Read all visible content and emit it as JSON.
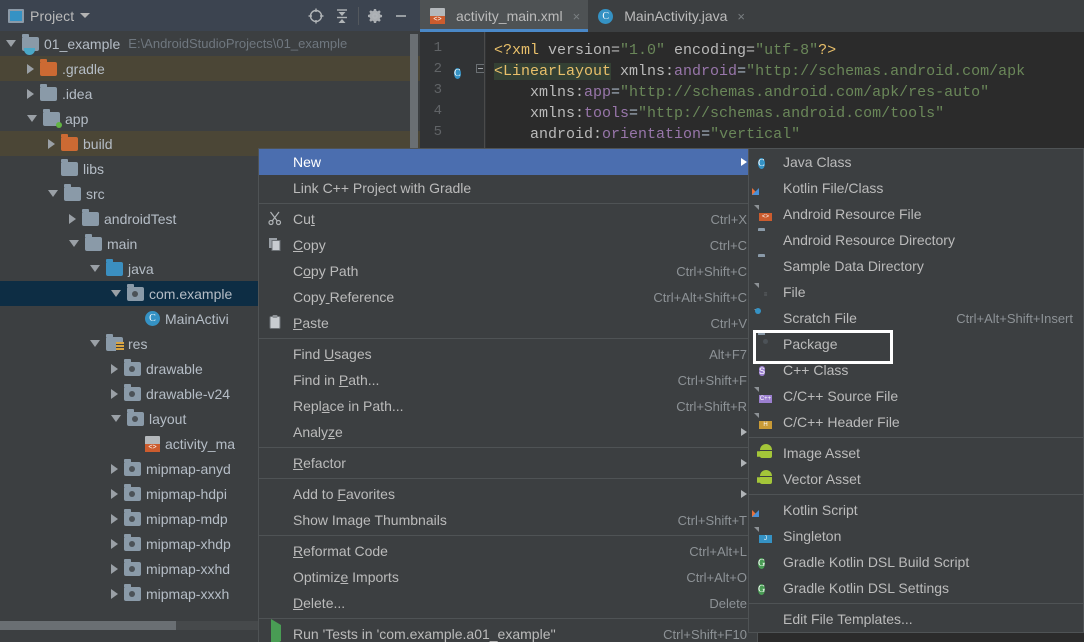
{
  "project_panel": {
    "title": "Project",
    "toolbar": [
      {
        "name": "locate-icon",
        "label": "Select Opened File"
      },
      {
        "name": "collapse-all-icon",
        "label": "Collapse All"
      },
      {
        "name": "gear-icon",
        "label": "Settings"
      },
      {
        "name": "minimize-icon",
        "label": "Hide"
      }
    ],
    "tree": [
      {
        "label": "01_example",
        "path": "E:\\AndroidStudioProjects\\01_example",
        "indent": 0,
        "arrow": "down",
        "icon": "project-folder",
        "state": "normal"
      },
      {
        "label": ".gradle",
        "path": "",
        "indent": 1,
        "arrow": "right",
        "icon": "folder-orange",
        "state": "changed"
      },
      {
        "label": ".idea",
        "path": "",
        "indent": 1,
        "arrow": "right",
        "icon": "folder",
        "state": "normal"
      },
      {
        "label": "app",
        "path": "",
        "indent": 1,
        "arrow": "down",
        "icon": "folder-module",
        "state": "normal"
      },
      {
        "label": "build",
        "path": "",
        "indent": 2,
        "arrow": "right",
        "icon": "folder-orange",
        "state": "changed"
      },
      {
        "label": "libs",
        "path": "",
        "indent": 2,
        "arrow": "none",
        "icon": "folder",
        "state": "normal"
      },
      {
        "label": "src",
        "path": "",
        "indent": 2,
        "arrow": "down",
        "icon": "folder",
        "state": "normal"
      },
      {
        "label": "androidTest",
        "path": "",
        "indent": 3,
        "arrow": "right",
        "icon": "folder",
        "state": "normal"
      },
      {
        "label": "main",
        "path": "",
        "indent": 3,
        "arrow": "down",
        "icon": "folder",
        "state": "normal"
      },
      {
        "label": "java",
        "path": "",
        "indent": 4,
        "arrow": "down",
        "icon": "folder-blue",
        "state": "normal"
      },
      {
        "label": "com.example",
        "path": "",
        "indent": 5,
        "arrow": "down",
        "icon": "package",
        "state": "selected"
      },
      {
        "label": "MainActivi",
        "path": "",
        "indent": 6,
        "arrow": "none",
        "icon": "java-class",
        "state": "normal"
      },
      {
        "label": "res",
        "path": "",
        "indent": 4,
        "arrow": "down",
        "icon": "res-folder",
        "state": "normal"
      },
      {
        "label": "drawable",
        "path": "",
        "indent": 5,
        "arrow": "right",
        "icon": "package",
        "state": "normal"
      },
      {
        "label": "drawable-v24",
        "path": "",
        "indent": 5,
        "arrow": "right",
        "icon": "package",
        "state": "normal"
      },
      {
        "label": "layout",
        "path": "",
        "indent": 5,
        "arrow": "down",
        "icon": "package",
        "state": "normal"
      },
      {
        "label": "activity_ma",
        "path": "",
        "indent": 6,
        "arrow": "none",
        "icon": "xml-file",
        "state": "normal"
      },
      {
        "label": "mipmap-anyd",
        "path": "",
        "indent": 5,
        "arrow": "right",
        "icon": "package",
        "state": "normal"
      },
      {
        "label": "mipmap-hdpi",
        "path": "",
        "indent": 5,
        "arrow": "right",
        "icon": "package",
        "state": "normal"
      },
      {
        "label": "mipmap-mdp",
        "path": "",
        "indent": 5,
        "arrow": "right",
        "icon": "package",
        "state": "normal"
      },
      {
        "label": "mipmap-xhdp",
        "path": "",
        "indent": 5,
        "arrow": "right",
        "icon": "package",
        "state": "normal"
      },
      {
        "label": "mipmap-xxhd",
        "path": "",
        "indent": 5,
        "arrow": "right",
        "icon": "package",
        "state": "normal"
      },
      {
        "label": "mipmap-xxxh",
        "path": "",
        "indent": 5,
        "arrow": "right",
        "icon": "package",
        "state": "normal"
      }
    ]
  },
  "editor": {
    "tabs": [
      {
        "label": "activity_main.xml",
        "icon": "xml-file-icon",
        "active": true,
        "close": "×"
      },
      {
        "label": "MainActivity.java",
        "icon": "java-class-icon",
        "active": false,
        "close": "×"
      }
    ],
    "line_numbers": [
      "1",
      "2",
      "3",
      "4",
      "5"
    ],
    "code_lines": [
      {
        "n": "1",
        "parts": [
          {
            "t": "<?xml ",
            "c": "k-proc"
          },
          {
            "t": "version=",
            "c": "k-attr"
          },
          {
            "t": "\"1.0\"",
            "c": "k-str"
          },
          {
            "t": " encoding=",
            "c": "k-attr"
          },
          {
            "t": "\"utf-8\"",
            "c": "k-str"
          },
          {
            "t": "?>",
            "c": "k-proc"
          }
        ]
      },
      {
        "n": "2",
        "parts": [
          {
            "t": "<LinearLayout",
            "c": "k-tagname hl-tag"
          },
          {
            "t": " xmlns:",
            "c": "k-attr"
          },
          {
            "t": "android",
            "c": "k-ns"
          },
          {
            "t": "=",
            "c": "k-punct"
          },
          {
            "t": "\"http://schemas.android.com/apk",
            "c": "k-str"
          }
        ]
      },
      {
        "n": "3",
        "parts": [
          {
            "t": "    xmlns:",
            "c": "k-attr"
          },
          {
            "t": "app",
            "c": "k-ns"
          },
          {
            "t": "=",
            "c": "k-punct"
          },
          {
            "t": "\"http://schemas.android.com/apk/res-auto\"",
            "c": "k-str"
          }
        ]
      },
      {
        "n": "4",
        "parts": [
          {
            "t": "    xmlns:",
            "c": "k-attr"
          },
          {
            "t": "tools",
            "c": "k-ns"
          },
          {
            "t": "=",
            "c": "k-punct"
          },
          {
            "t": "\"http://schemas.android.com/tools\"",
            "c": "k-str"
          }
        ]
      },
      {
        "n": "5",
        "parts": [
          {
            "t": "    android:",
            "c": "k-attr"
          },
          {
            "t": "orientation",
            "c": "k-ns"
          },
          {
            "t": "=",
            "c": "k-punct"
          },
          {
            "t": "\"vertical\"",
            "c": "k-str"
          }
        ]
      }
    ]
  },
  "context_menu": {
    "items": [
      {
        "label": "New",
        "shortcut": "",
        "icon": "",
        "submenu": true,
        "selected": true,
        "mnemonic": ""
      },
      {
        "label": "Link C++ Project with Gradle",
        "shortcut": "",
        "icon": "",
        "submenu": false,
        "selected": false
      },
      {
        "sep": true
      },
      {
        "label": "Cut",
        "shortcut": "Ctrl+X",
        "icon": "scissors-icon",
        "submenu": false,
        "selected": false
      },
      {
        "label": "Copy",
        "shortcut": "Ctrl+C",
        "icon": "copy-icon",
        "submenu": false,
        "selected": false
      },
      {
        "label": "Copy Path",
        "shortcut": "Ctrl+Shift+C",
        "icon": "",
        "submenu": false,
        "selected": false
      },
      {
        "label": "Copy Reference",
        "shortcut": "Ctrl+Alt+Shift+C",
        "icon": "",
        "submenu": false,
        "selected": false
      },
      {
        "label": "Paste",
        "shortcut": "Ctrl+V",
        "icon": "paste-icon",
        "submenu": false,
        "selected": false
      },
      {
        "sep": true
      },
      {
        "label": "Find Usages",
        "shortcut": "Alt+F7",
        "icon": "",
        "submenu": false,
        "selected": false
      },
      {
        "label": "Find in Path...",
        "shortcut": "Ctrl+Shift+F",
        "icon": "",
        "submenu": false,
        "selected": false
      },
      {
        "label": "Replace in Path...",
        "shortcut": "Ctrl+Shift+R",
        "icon": "",
        "submenu": false,
        "selected": false
      },
      {
        "label": "Analyze",
        "shortcut": "",
        "icon": "",
        "submenu": true,
        "selected": false
      },
      {
        "sep": true
      },
      {
        "label": "Refactor",
        "shortcut": "",
        "icon": "",
        "submenu": true,
        "selected": false
      },
      {
        "sep": true
      },
      {
        "label": "Add to Favorites",
        "shortcut": "",
        "icon": "",
        "submenu": true,
        "selected": false
      },
      {
        "label": "Show Image Thumbnails",
        "shortcut": "Ctrl+Shift+T",
        "icon": "",
        "submenu": false,
        "selected": false
      },
      {
        "sep": true
      },
      {
        "label": "Reformat Code",
        "shortcut": "Ctrl+Alt+L",
        "icon": "",
        "submenu": false,
        "selected": false
      },
      {
        "label": "Optimize Imports",
        "shortcut": "Ctrl+Alt+O",
        "icon": "",
        "submenu": false,
        "selected": false
      },
      {
        "label": "Delete...",
        "shortcut": "Delete",
        "icon": "",
        "submenu": false,
        "selected": false
      },
      {
        "sep": true
      },
      {
        "label": "Run 'Tests in 'com.example.a01_example''",
        "shortcut": "Ctrl+Shift+F10",
        "icon": "run-icon",
        "submenu": false,
        "selected": false
      }
    ]
  },
  "new_submenu": {
    "items": [
      {
        "label": "Java Class",
        "shortcut": "",
        "icon": "java-class-icon",
        "boxed": false
      },
      {
        "label": "Kotlin File/Class",
        "shortcut": "",
        "icon": "kotlin-file-icon",
        "boxed": false
      },
      {
        "label": "Android Resource File",
        "shortcut": "",
        "icon": "android-resource-file-icon",
        "boxed": false
      },
      {
        "label": "Android Resource Directory",
        "shortcut": "",
        "icon": "folder-icon",
        "boxed": false
      },
      {
        "label": "Sample Data Directory",
        "shortcut": "",
        "icon": "folder-icon",
        "boxed": false
      },
      {
        "label": "File",
        "shortcut": "",
        "icon": "file-icon",
        "boxed": false
      },
      {
        "label": "Scratch File",
        "shortcut": "Ctrl+Alt+Shift+Insert",
        "icon": "scratch-file-icon",
        "boxed": false
      },
      {
        "label": "Package",
        "shortcut": "",
        "icon": "package-icon",
        "boxed": true
      },
      {
        "label": "C++ Class",
        "shortcut": "",
        "icon": "cpp-class-icon",
        "boxed": false
      },
      {
        "label": "C/C++ Source File",
        "shortcut": "",
        "icon": "cpp-source-icon",
        "boxed": false
      },
      {
        "label": "C/C++ Header File",
        "shortcut": "",
        "icon": "cpp-header-icon",
        "boxed": false
      },
      {
        "sep": true
      },
      {
        "label": "Image Asset",
        "shortcut": "",
        "icon": "android-icon",
        "boxed": false
      },
      {
        "label": "Vector Asset",
        "shortcut": "",
        "icon": "android-icon",
        "boxed": false
      },
      {
        "sep": true
      },
      {
        "label": "Kotlin Script",
        "shortcut": "",
        "icon": "kotlin-file-icon",
        "boxed": false
      },
      {
        "label": "Singleton",
        "shortcut": "",
        "icon": "java-file-icon",
        "boxed": false
      },
      {
        "label": "Gradle Kotlin DSL Build Script",
        "shortcut": "",
        "icon": "gradle-icon",
        "boxed": false
      },
      {
        "label": "Gradle Kotlin DSL Settings",
        "shortcut": "",
        "icon": "gradle-icon",
        "boxed": false
      },
      {
        "sep": true
      },
      {
        "label": "Edit File Templates...",
        "shortcut": "",
        "icon": "",
        "boxed": false
      }
    ]
  },
  "colors": {
    "accent_selection": "#4b6eaf",
    "menu_bg": "#3c3f41",
    "panel_bg": "#3c3f41",
    "editor_bg": "#2b2b2b",
    "tree_selected": "#0d2d44",
    "tree_changed": "#4b4636",
    "highlight_box": "#ffffff",
    "tab_underline": "#4a88c7"
  }
}
